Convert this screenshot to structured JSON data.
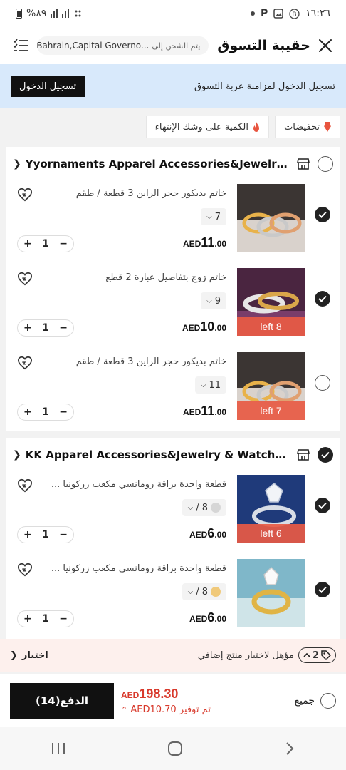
{
  "status_bar": {
    "battery": "%٨٩",
    "time": "١٦:٢٦"
  },
  "header": {
    "title": "حقيبة التسوق",
    "ship_label": "يتم الشحن إلى",
    "location": "Bahrain,Capital Governo...",
    "icons": [
      "close-icon",
      "location-pin-icon",
      "list-icon"
    ]
  },
  "login_banner": {
    "message": "تسجيل الدخول لمزامنة عربة التسوق",
    "button": "تسجيل الدخول"
  },
  "filters": [
    {
      "label": "تخفيضات",
      "icon": "sale-tag-icon",
      "color": "#e8553f"
    },
    {
      "label": "الكمية على وشك الإنتهاء",
      "icon": "fire-icon",
      "color": "#e8553f"
    }
  ],
  "stores": [
    {
      "name": "Yyornaments Apparel Accessories&Jewelry ...",
      "selected": false,
      "items": [
        {
          "name": "خاتم بديكور حجر الراين 3 قطعة / طقم",
          "variant": "7",
          "price_currency": "AED",
          "price_int": "11",
          "price_dec": ".00",
          "qty": "1",
          "selected": true,
          "left_badge": ""
        },
        {
          "name": "خاتم زوج بتفاصيل عبارة 2 قطع",
          "variant": "9",
          "price_currency": "AED",
          "price_int": "10",
          "price_dec": ".00",
          "qty": "1",
          "selected": true,
          "left_badge": "8 left"
        },
        {
          "name": "خاتم بديكور حجر الراين 3 قطعة / طقم",
          "variant": "11",
          "price_currency": "AED",
          "price_int": "11",
          "price_dec": ".00",
          "qty": "1",
          "selected": false,
          "left_badge": "7 left"
        }
      ]
    },
    {
      "name": "KK Apparel Accessories&Jewelry & Watche...",
      "selected": true,
      "items": [
        {
          "name": "قطعة واحدة براقة رومانسي مكعب زركونيا ...",
          "variant": "8 /",
          "swatch_color": "#d6d6d6",
          "price_currency": "AED",
          "price_int": "6",
          "price_dec": ".00",
          "qty": "1",
          "selected": true,
          "left_badge": "6 left"
        },
        {
          "name": "قطعة واحدة براقة رومانسي مكعب زركونيا ...",
          "variant": "8 /",
          "swatch_color": "#f0c97a",
          "price_currency": "AED",
          "price_int": "6",
          "price_dec": ".00",
          "qty": "1",
          "selected": true,
          "left_badge": ""
        }
      ]
    }
  ],
  "addon_bar": {
    "badge": "2",
    "message": "مؤهل لاختيار منتج إضافي",
    "choose": "اختيار"
  },
  "checkout": {
    "select_all": "جميع",
    "total_currency": "AED",
    "total": "198.30",
    "saving": "تم توفير AED10.70",
    "pay_button": "الدفع(14)"
  },
  "colors": {
    "accent": "#d8392b",
    "badge": "#e85a44",
    "login_bg": "#d8e9fb",
    "dark": "#111111"
  }
}
